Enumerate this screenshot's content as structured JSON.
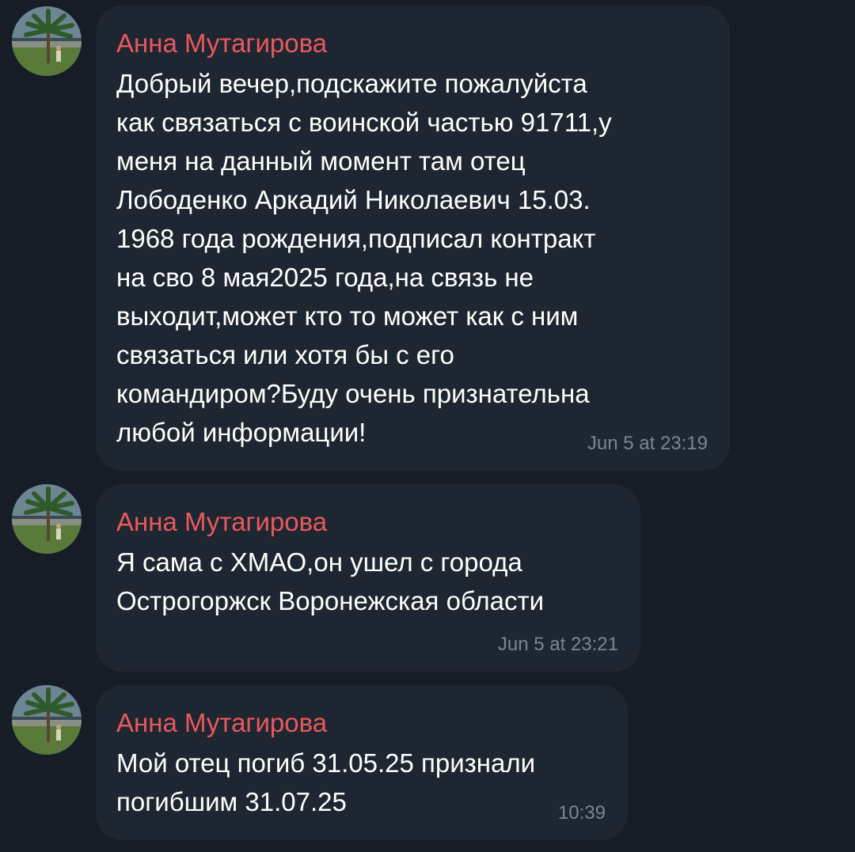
{
  "colors": {
    "background": "#161d26",
    "bubble": "#1e2631",
    "sender_name": "#e9595c",
    "message_text": "#ffffff",
    "timestamp": "#7b8694"
  },
  "messages": [
    {
      "sender": "Анна Мутагирова",
      "avatar_icon": "user-avatar-photo-palm-tree",
      "text": "Добрый вечер,подскажите пожалуйста\nкак связаться с воинской частью 91711,у\nменя на данный момент там отец\nЛободенко Аркадий Николаевич 15.03.\n1968 года рождения,подписал контракт\nна сво 8 мая2025 года,на связь не\nвыходит,может кто то может как с ним\nсвязаться или хотя бы с его\nкомандиром?Буду очень признательна\nлюбой информации!",
      "time": "Jun 5 at 23:19"
    },
    {
      "sender": "Анна Мутагирова",
      "avatar_icon": "user-avatar-photo-palm-tree",
      "text": "Я сама с ХМАО,он ушел с города\nОстрогоржск Воронежская области",
      "time": "Jun 5 at 23:21"
    },
    {
      "sender": "Анна Мутагирова",
      "avatar_icon": "user-avatar-photo-palm-tree",
      "text": "Мой отец погиб 31.05.25 признали\nпогибшим 31.07.25",
      "time": "10:39"
    }
  ]
}
